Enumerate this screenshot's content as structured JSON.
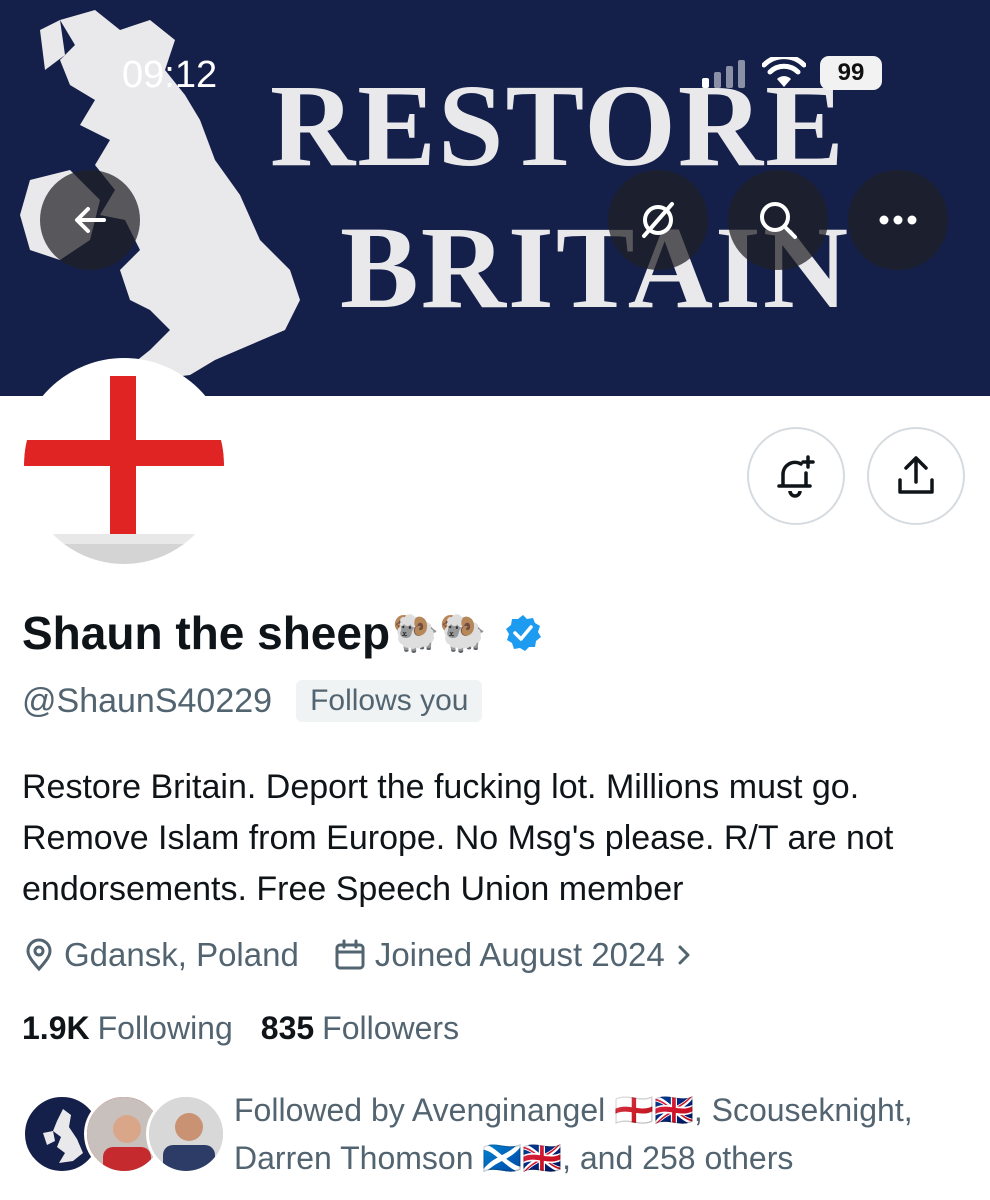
{
  "status_bar": {
    "time": "09:12",
    "battery": "99"
  },
  "banner": {
    "line1": "RESTORE",
    "line2": "BRITAIN"
  },
  "header_buttons": {
    "back": "back-arrow-icon",
    "grok": "grok-icon",
    "search": "search-icon",
    "more": "more-icon"
  },
  "profile": {
    "display_name": "Shaun the sheep",
    "name_emoji": "🐏🐏",
    "handle": "@ShaunS40229",
    "follows_you": "Follows you",
    "bio": "Restore Britain. Deport the fucking lot. Millions must go. Remove Islam from Europe. No Msg's please. R/T are not endorsements. Free Speech Union member",
    "location": "Gdansk, Poland",
    "joined": "Joined August 2024",
    "following_count": "1.9K",
    "following_label": "Following",
    "followers_count": "835",
    "followers_label": "Followers",
    "followed_by": "Followed by Avenginangel 🏴󠁧󠁢󠁥󠁮󠁧󠁿🇬🇧, Scouseknight, Darren Thomson 🏴󠁧󠁢󠁳󠁣󠁴󠁿🇬🇧, and 258 others"
  },
  "colors": {
    "banner_bg": "#15204a",
    "verified": "#1d9bf0",
    "cross_red": "#e02424",
    "secondary_text": "#536471"
  }
}
